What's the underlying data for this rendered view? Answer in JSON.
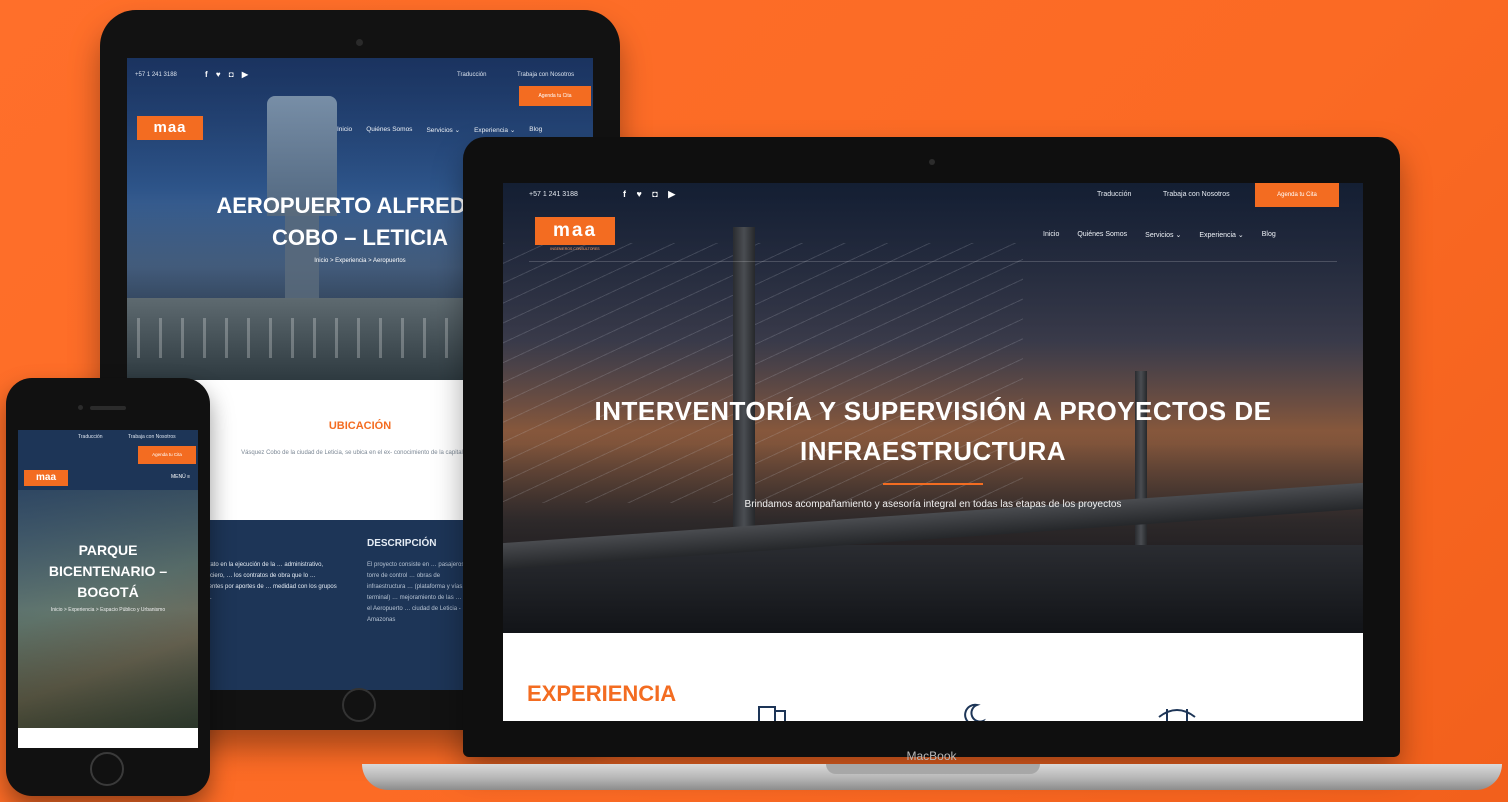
{
  "colors": {
    "background": "#fb6a24",
    "accent": "#f36c21",
    "navy": "#1d3557"
  },
  "tablet": {
    "phone": "+57 1 241 3188",
    "social": "f ♥ ◘ ▶",
    "lang": "Traducción",
    "work": "Trabaja con Nosotros",
    "cta": "Agenda tu Cita",
    "logo": "maa",
    "nav": [
      "Inicio",
      "Quiénes Somos",
      "Servicios ⌄",
      "Experiencia ⌄",
      "Blog"
    ],
    "title_line1": "AEROPUERTO ALFREDO V",
    "title_line2": "COBO – LETICIA",
    "breadcrumb": "Inicio > Experiencia > Aeropuertos",
    "ubicacion_heading": "UBICACIÓN",
    "ubicacion_text": "Vásquez Cobo de la ciudad de Leticia, se ubica en el ex- conocimiento de la capital del departamento.",
    "desc_left": "contrato en la ejecución de la … administrativo, financiero, … los contratos de obra que lo … diferentes por aportes de … medidad con los grupos 1 y 2.",
    "desc_heading": "DESCRIPCIÓN",
    "desc_right": "El proyecto consiste en … pasajeros, torre de control … obras de infraestructura … (plataforma y vías, terminal) … mejoramiento de las … para el Aeropuerto … ciudad de Leticia - Amazonas"
  },
  "phone": {
    "lang": "Traducción",
    "work": "Trabaja con Nosotros",
    "cta": "Agenda tu Cita",
    "logo": "maa",
    "menu": "MENÚ ≡",
    "title_line1": "PARQUE",
    "title_line2": "BICENTENARIO –",
    "title_line3": "BOGOTÁ",
    "subtitle": "Inicio > Experiencia > Espacio Público y Urbanismo"
  },
  "laptop": {
    "phone": "+57 1 241 3188",
    "social": "f ♥ ◘ ▶",
    "lang": "Traducción",
    "work": "Trabaja con Nosotros",
    "cta": "Agenda tu Cita",
    "logo": "maa",
    "logo_sub": "INGENIEROS CONSULTORES",
    "nav": [
      "Inicio",
      "Quiénes Somos",
      "Servicios ⌄",
      "Experiencia ⌄",
      "Blog"
    ],
    "title_line1": "INTERVENTORÍA Y SUPERVISIÓN A PROYECTOS DE",
    "title_line2": "INFRAESTRUCTURA",
    "subtitle": "Brindamos acompañamiento y asesoría integral en todas las etapas de los proyectos",
    "section_heading": "EXPERIENCIA",
    "icons": [
      "building-icon",
      "moon-icon",
      "bridge-icon"
    ],
    "brand": "MacBook"
  }
}
